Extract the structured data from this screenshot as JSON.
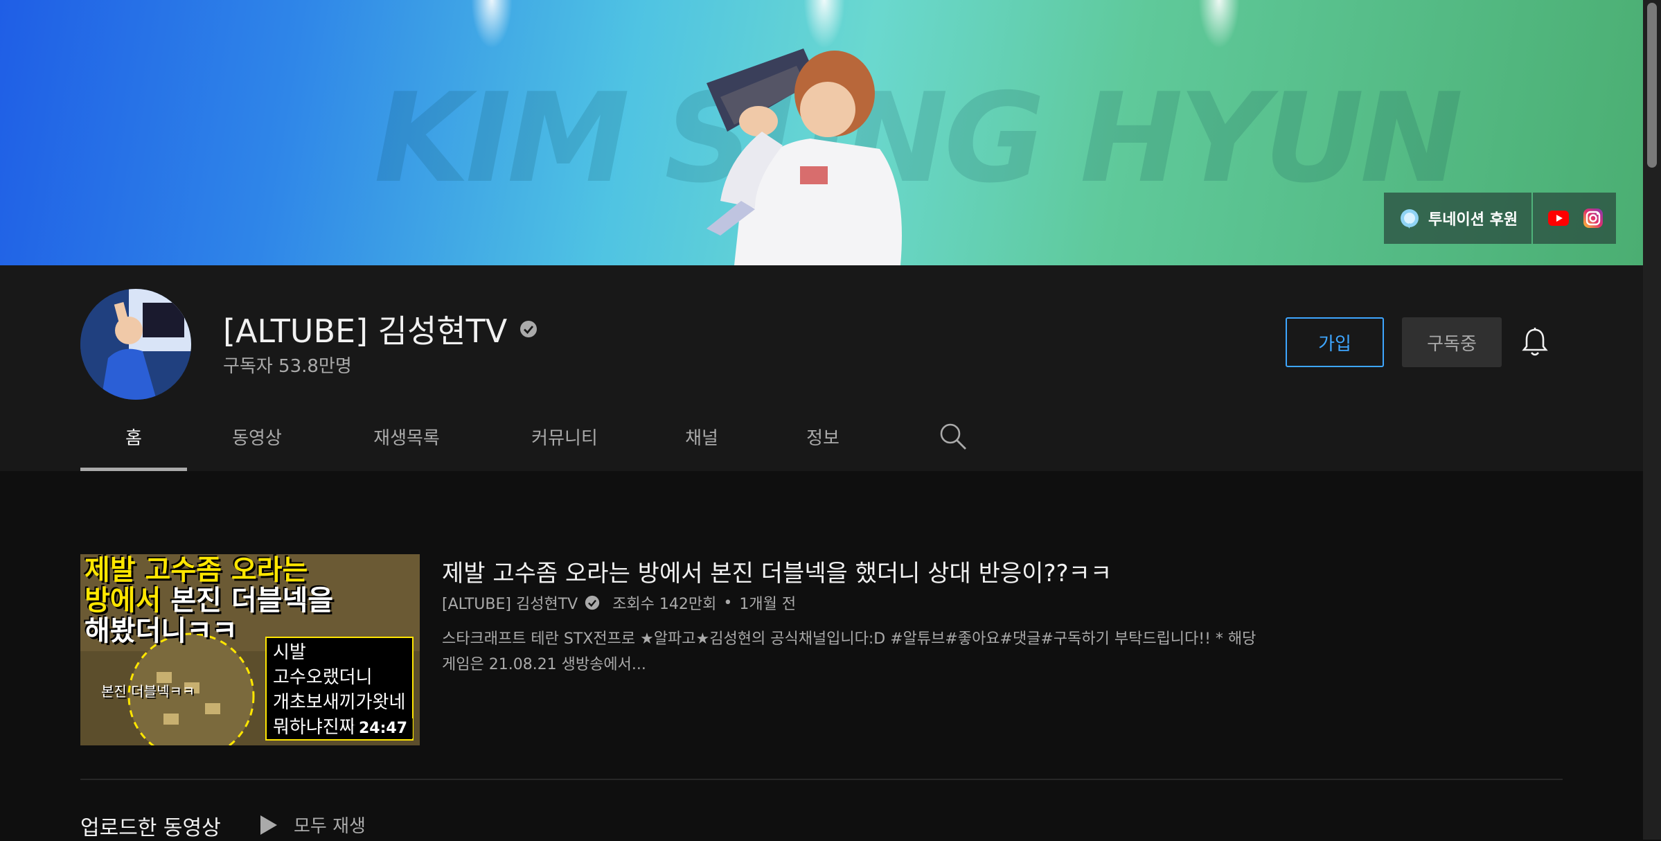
{
  "banner": {
    "overlay_text": "KIM SUNG HYUN",
    "donation_label": "투네이션 후원",
    "social_icons": [
      "youtube-icon",
      "instagram-icon"
    ]
  },
  "channel": {
    "name": "[ALTUBE] 김성현TV",
    "subscribers": "구독자 53.8만명",
    "verified_icon": "verified-check-icon"
  },
  "actions": {
    "join_label": "가입",
    "subscribed_label": "구독중",
    "bell_icon": "bell-icon"
  },
  "tabs": [
    {
      "label": "홈",
      "active": true
    },
    {
      "label": "동영상"
    },
    {
      "label": "재생목록"
    },
    {
      "label": "커뮤니티"
    },
    {
      "label": "채널"
    },
    {
      "label": "정보"
    }
  ],
  "featured_video": {
    "thumbnail": {
      "line1": "제발 고수좀 오라는",
      "line2a": "방에서",
      "line2b": " 본진 더블넥을",
      "line3": "해봤더니ㅋㅋ",
      "circle_label": "본진 더블넥ㅋㅋ",
      "chat1": "시발",
      "chat2": "고수오랬더니",
      "chat3": "개초보새끼가왓네",
      "chat4": "뭐하냐진짜"
    },
    "duration": "24:47",
    "title": "제발 고수좀 오라는 방에서 본진 더블넥을 했더니 상대 반응이??ㅋㅋ",
    "channel": "[ALTUBE] 김성현TV",
    "views": "조회수 142만회",
    "separator": "•",
    "age": "1개월 전",
    "description": "스타크래프트 테란 STX전프로 ★알파고★김성현의 공식채널입니다:D #알튜브#좋아요#댓글#구독하기 부탁드립니다!! * 해당 게임은 21.08.21 생방송에서..."
  },
  "uploads": {
    "title": "업로드한 동영상",
    "play_all": "모두 재생"
  },
  "colors": {
    "accent": "#3ea6ff",
    "background": "#0f0f0f",
    "header_bg": "#181818",
    "thumb_yellow": "#ffe600"
  }
}
